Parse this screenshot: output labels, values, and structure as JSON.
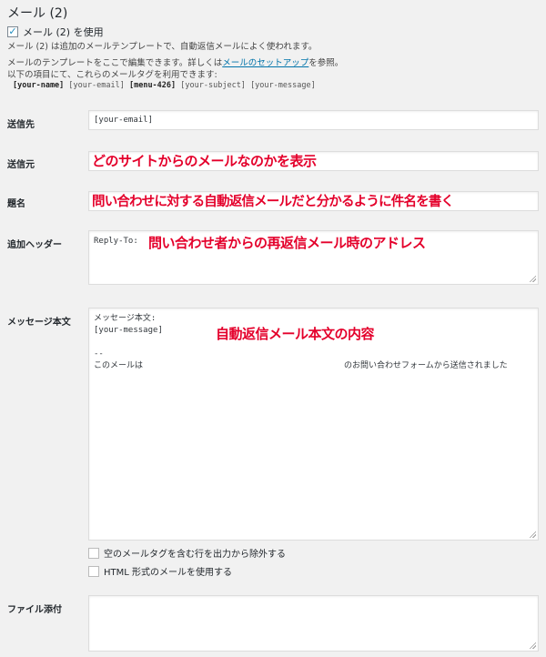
{
  "title": "メール (2)",
  "enable_label": "メール (2) を使用",
  "enable_checked": true,
  "desc1": "メール (2) は追加のメールテンプレートで、自動返信メールによく使われます。",
  "desc2_prefix": "メールのテンプレートをここで編集できます。詳しくは",
  "desc2_link": "メールのセットアップ",
  "desc2_suffix": "を参照。",
  "desc3": "以下の項目にて、これらのメールタグを利用できます:",
  "tags": [
    {
      "text": "[your-name]",
      "bold": true
    },
    {
      "text": "[your-email]",
      "bold": false
    },
    {
      "text": "[menu-426]",
      "bold": true
    },
    {
      "text": "[your-subject]",
      "bold": false
    },
    {
      "text": "[your-message]",
      "bold": false
    }
  ],
  "fields": {
    "to": {
      "label": "送信先",
      "value": "[your-email]"
    },
    "from": {
      "label": "送信元",
      "value": "",
      "note": "どのサイトからのメールなのかを表示"
    },
    "subject": {
      "label": "題名",
      "value": "",
      "note": "問い合わせに対する自動返信メールだと分かるように件名を書く"
    },
    "headers": {
      "label": "追加ヘッダー",
      "value": "Reply-To:",
      "note": "問い合わせ者からの再返信メール時のアドレス"
    },
    "body": {
      "label": "メッセージ本文",
      "line1": "メッセージ本文:",
      "line2": "[your-message]",
      "line3": "--",
      "line4_start": "このメールは",
      "line4_end": "のお問い合わせフォームから送信されました",
      "note": "自動返信メール本文の内容"
    },
    "attachments": {
      "label": "ファイル添付",
      "value": ""
    }
  },
  "options": [
    {
      "label": "空のメールタグを含む行を出力から除外する",
      "checked": false
    },
    {
      "label": "HTML 形式のメールを使用する",
      "checked": false
    }
  ]
}
